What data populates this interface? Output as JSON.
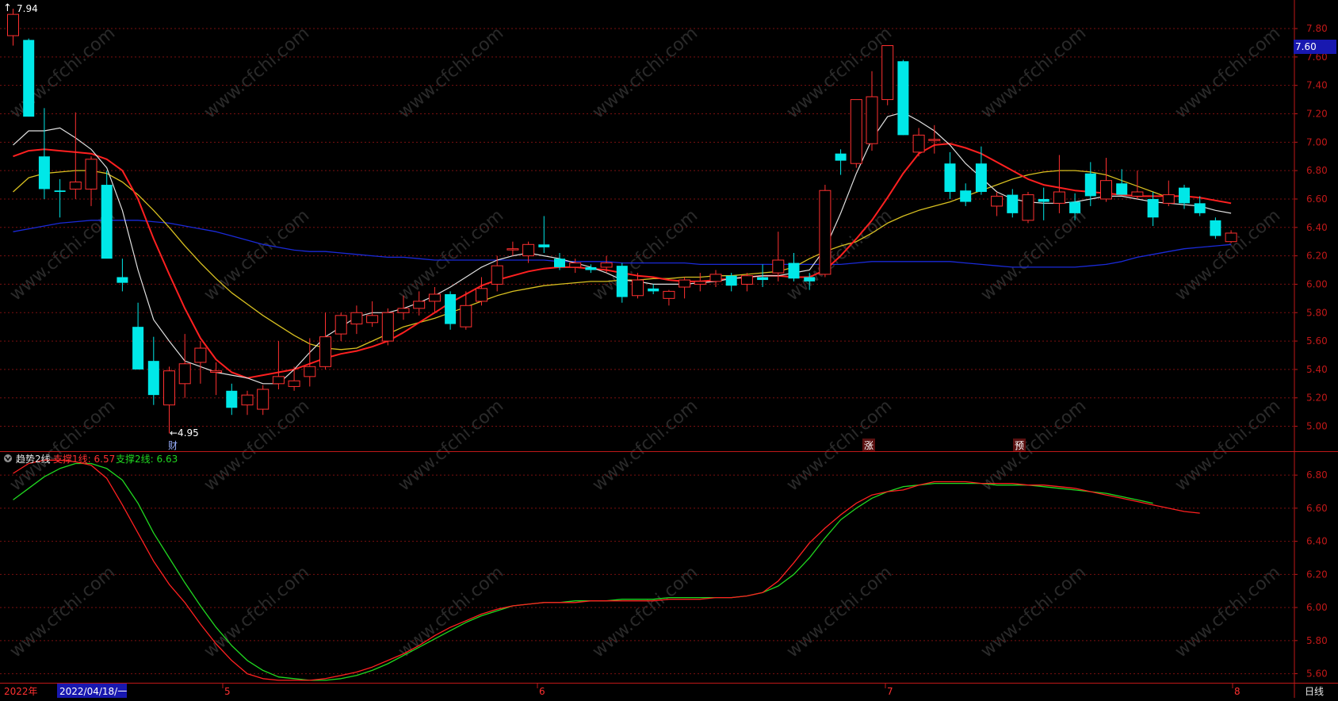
{
  "colors": {
    "background": "#000000",
    "grid": "#7a1010",
    "frame": "#c01818",
    "axis_text": "#c8c8c8",
    "candle_up": "#ff3030",
    "candle_down": "#00e8e8",
    "ma_white": "#e0e0e0",
    "ma_red": "#ff2020",
    "ma_yellow": "#d8c020",
    "ma_blue": "#1a2ad8",
    "support1": "#ff2020",
    "support2": "#20d820",
    "watermark": "#2a2a2a"
  },
  "watermark_text": "www.cfchi.com",
  "price_panel": {
    "y_ticks": [
      "7.80",
      "7.60",
      "7.40",
      "7.20",
      "7.00",
      "6.80",
      "6.60",
      "6.40",
      "6.20",
      "6.00",
      "5.80",
      "5.60",
      "5.40",
      "5.20",
      "5.00"
    ],
    "current_price_label": "7.60",
    "high_marker": "7.94",
    "low_marker": "←4.95",
    "event_markers": [
      "财",
      "涨",
      "预"
    ]
  },
  "indicator_panel": {
    "name": "趋势2线",
    "line1_label": "支撑1线: 6.57",
    "line2_label": "支撑2线: 6.63",
    "y_ticks": [
      "6.80",
      "6.60",
      "6.40",
      "6.20",
      "6.00",
      "5.80",
      "5.60"
    ]
  },
  "bottom_axis": {
    "year_label": "2022年",
    "selected_date": "2022/04/18/一",
    "months": [
      "5",
      "6",
      "7",
      "8"
    ],
    "period_label": "日线"
  },
  "chart_data": {
    "type": "candlestick",
    "price_range": [
      4.83,
      7.99
    ],
    "indicator_range": [
      5.55,
      6.93
    ],
    "candles": [
      {
        "o": 7.75,
        "h": 7.94,
        "l": 7.68,
        "c": 7.9
      },
      {
        "o": 7.72,
        "h": 7.73,
        "l": 7.18,
        "c": 7.18
      },
      {
        "o": 6.9,
        "h": 7.24,
        "l": 6.6,
        "c": 6.67
      },
      {
        "o": 6.66,
        "h": 6.74,
        "l": 6.47,
        "c": 6.65
      },
      {
        "o": 6.67,
        "h": 7.21,
        "l": 6.6,
        "c": 6.72
      },
      {
        "o": 6.67,
        "h": 6.9,
        "l": 6.55,
        "c": 6.88
      },
      {
        "o": 6.7,
        "h": 6.8,
        "l": 6.2,
        "c": 6.18
      },
      {
        "o": 6.05,
        "h": 6.18,
        "l": 5.95,
        "c": 6.01
      },
      {
        "o": 5.7,
        "h": 5.87,
        "l": 5.4,
        "c": 5.4
      },
      {
        "o": 5.46,
        "h": 5.63,
        "l": 5.15,
        "c": 5.22
      },
      {
        "o": 5.15,
        "h": 5.42,
        "l": 4.95,
        "c": 5.39
      },
      {
        "o": 5.3,
        "h": 5.65,
        "l": 5.2,
        "c": 5.44
      },
      {
        "o": 5.45,
        "h": 5.6,
        "l": 5.3,
        "c": 5.55
      },
      {
        "o": 5.38,
        "h": 5.45,
        "l": 5.22,
        "c": 5.39
      },
      {
        "o": 5.25,
        "h": 5.3,
        "l": 5.08,
        "c": 5.13
      },
      {
        "o": 5.15,
        "h": 5.25,
        "l": 5.08,
        "c": 5.22
      },
      {
        "o": 5.12,
        "h": 5.29,
        "l": 5.08,
        "c": 5.26
      },
      {
        "o": 5.3,
        "h": 5.6,
        "l": 5.26,
        "c": 5.35
      },
      {
        "o": 5.28,
        "h": 5.42,
        "l": 5.25,
        "c": 5.32
      },
      {
        "o": 5.35,
        "h": 5.62,
        "l": 5.28,
        "c": 5.42
      },
      {
        "o": 5.42,
        "h": 5.8,
        "l": 5.4,
        "c": 5.63
      },
      {
        "o": 5.65,
        "h": 5.8,
        "l": 5.6,
        "c": 5.78
      },
      {
        "o": 5.72,
        "h": 5.85,
        "l": 5.65,
        "c": 5.8
      },
      {
        "o": 5.73,
        "h": 5.88,
        "l": 5.7,
        "c": 5.78
      },
      {
        "o": 5.6,
        "h": 5.83,
        "l": 5.57,
        "c": 5.8
      },
      {
        "o": 5.8,
        "h": 5.92,
        "l": 5.75,
        "c": 5.83
      },
      {
        "o": 5.83,
        "h": 5.95,
        "l": 5.78,
        "c": 5.88
      },
      {
        "o": 5.88,
        "h": 5.98,
        "l": 5.8,
        "c": 5.93
      },
      {
        "o": 5.93,
        "h": 5.95,
        "l": 5.68,
        "c": 5.72
      },
      {
        "o": 5.7,
        "h": 5.95,
        "l": 5.68,
        "c": 5.85
      },
      {
        "o": 5.88,
        "h": 6.05,
        "l": 5.85,
        "c": 5.97
      },
      {
        "o": 6.0,
        "h": 6.2,
        "l": 5.95,
        "c": 6.13
      },
      {
        "o": 6.25,
        "h": 6.3,
        "l": 6.2,
        "c": 6.25
      },
      {
        "o": 6.2,
        "h": 6.3,
        "l": 6.15,
        "c": 6.28
      },
      {
        "o": 6.28,
        "h": 6.48,
        "l": 6.22,
        "c": 6.26
      },
      {
        "o": 6.18,
        "h": 6.22,
        "l": 6.1,
        "c": 6.12
      },
      {
        "o": 6.12,
        "h": 6.18,
        "l": 6.08,
        "c": 6.15
      },
      {
        "o": 6.12,
        "h": 6.14,
        "l": 6.08,
        "c": 6.1
      },
      {
        "o": 6.12,
        "h": 6.2,
        "l": 6.08,
        "c": 6.15
      },
      {
        "o": 6.13,
        "h": 6.15,
        "l": 5.87,
        "c": 5.91
      },
      {
        "o": 5.92,
        "h": 6.08,
        "l": 5.9,
        "c": 6.03
      },
      {
        "o": 5.97,
        "h": 6.0,
        "l": 5.93,
        "c": 5.95
      },
      {
        "o": 5.9,
        "h": 5.96,
        "l": 5.85,
        "c": 5.95
      },
      {
        "o": 5.98,
        "h": 6.05,
        "l": 5.9,
        "c": 6.03
      },
      {
        "o": 6.0,
        "h": 6.08,
        "l": 5.95,
        "c": 6.02
      },
      {
        "o": 6.02,
        "h": 6.1,
        "l": 5.98,
        "c": 6.07
      },
      {
        "o": 6.06,
        "h": 6.08,
        "l": 5.95,
        "c": 5.99
      },
      {
        "o": 6.0,
        "h": 6.08,
        "l": 5.95,
        "c": 6.06
      },
      {
        "o": 6.05,
        "h": 6.14,
        "l": 5.98,
        "c": 6.03
      },
      {
        "o": 6.08,
        "h": 6.37,
        "l": 6.02,
        "c": 6.17
      },
      {
        "o": 6.15,
        "h": 6.22,
        "l": 6.02,
        "c": 6.04
      },
      {
        "o": 6.05,
        "h": 6.08,
        "l": 5.96,
        "c": 6.02
      },
      {
        "o": 6.07,
        "h": 6.7,
        "l": 6.05,
        "c": 6.66
      },
      {
        "o": 6.92,
        "h": 6.95,
        "l": 6.77,
        "c": 6.87
      },
      {
        "o": 6.85,
        "h": 7.25,
        "l": 6.82,
        "c": 7.3
      },
      {
        "o": 6.99,
        "h": 7.5,
        "l": 6.94,
        "c": 7.32
      },
      {
        "o": 7.3,
        "h": 7.68,
        "l": 7.26,
        "c": 7.68
      },
      {
        "o": 7.57,
        "h": 7.58,
        "l": 7.05,
        "c": 7.05
      },
      {
        "o": 6.93,
        "h": 7.1,
        "l": 6.9,
        "c": 7.05
      },
      {
        "o": 7.02,
        "h": 7.12,
        "l": 6.92,
        "c": 7.02
      },
      {
        "o": 6.85,
        "h": 6.93,
        "l": 6.6,
        "c": 6.65
      },
      {
        "o": 6.66,
        "h": 6.71,
        "l": 6.55,
        "c": 6.58
      },
      {
        "o": 6.85,
        "h": 6.97,
        "l": 6.63,
        "c": 6.65
      },
      {
        "o": 6.55,
        "h": 6.65,
        "l": 6.48,
        "c": 6.62
      },
      {
        "o": 6.63,
        "h": 6.67,
        "l": 6.47,
        "c": 6.5
      },
      {
        "o": 6.45,
        "h": 6.65,
        "l": 6.43,
        "c": 6.63
      },
      {
        "o": 6.6,
        "h": 6.68,
        "l": 6.45,
        "c": 6.58
      },
      {
        "o": 6.57,
        "h": 6.91,
        "l": 6.5,
        "c": 6.65
      },
      {
        "o": 6.58,
        "h": 6.64,
        "l": 6.45,
        "c": 6.5
      },
      {
        "o": 6.78,
        "h": 6.86,
        "l": 6.55,
        "c": 6.62
      },
      {
        "o": 6.6,
        "h": 6.89,
        "l": 6.58,
        "c": 6.73
      },
      {
        "o": 6.71,
        "h": 6.81,
        "l": 6.63,
        "c": 6.63
      },
      {
        "o": 6.62,
        "h": 6.8,
        "l": 6.6,
        "c": 6.65
      },
      {
        "o": 6.6,
        "h": 6.65,
        "l": 6.41,
        "c": 6.47
      },
      {
        "o": 6.57,
        "h": 6.73,
        "l": 6.55,
        "c": 6.63
      },
      {
        "o": 6.68,
        "h": 6.7,
        "l": 6.53,
        "c": 6.57
      },
      {
        "o": 6.57,
        "h": 6.62,
        "l": 6.48,
        "c": 6.5
      },
      {
        "o": 6.45,
        "h": 6.47,
        "l": 6.32,
        "c": 6.34
      },
      {
        "o": 6.3,
        "h": 6.38,
        "l": 6.29,
        "c": 6.36
      }
    ],
    "ma_short": [
      6.98,
      7.08,
      7.08,
      7.1,
      7.03,
      6.95,
      6.82,
      6.52,
      6.1,
      5.75,
      5.6,
      5.46,
      5.42,
      5.38,
      5.36,
      5.34,
      5.3,
      5.3,
      5.4,
      5.52,
      5.63,
      5.7,
      5.77,
      5.8,
      5.8,
      5.83,
      5.87,
      5.92,
      5.98,
      6.05,
      6.12,
      6.17,
      6.2,
      6.22,
      6.2,
      6.18,
      6.15,
      6.12,
      6.08,
      6.03,
      6.02,
      6.0,
      6.0,
      6.0,
      6.01,
      6.02,
      6.04,
      6.05,
      6.06,
      6.06,
      6.08,
      6.1,
      6.25,
      6.5,
      6.78,
      7.02,
      7.18,
      7.21,
      7.15,
      7.08,
      6.98,
      6.85,
      6.75,
      6.65,
      6.6,
      6.58,
      6.57,
      6.57,
      6.58,
      6.6,
      6.62,
      6.62,
      6.6,
      6.58,
      6.57,
      6.56,
      6.55,
      6.52,
      6.5
    ],
    "ma_mid": [
      6.9,
      6.94,
      6.95,
      6.94,
      6.93,
      6.92,
      6.88,
      6.8,
      6.6,
      6.32,
      6.07,
      5.83,
      5.62,
      5.47,
      5.38,
      5.34,
      5.36,
      5.38,
      5.4,
      5.44,
      5.48,
      5.51,
      5.53,
      5.56,
      5.6,
      5.66,
      5.73,
      5.8,
      5.87,
      5.93,
      5.99,
      6.03,
      6.06,
      6.09,
      6.11,
      6.12,
      6.12,
      6.11,
      6.1,
      6.08,
      6.06,
      6.05,
      6.03,
      6.02,
      6.02,
      6.03,
      6.04,
      6.05,
      6.06,
      6.06,
      6.05,
      6.05,
      6.1,
      6.2,
      6.32,
      6.45,
      6.61,
      6.78,
      6.92,
      6.98,
      6.99,
      6.96,
      6.92,
      6.86,
      6.8,
      6.74,
      6.7,
      6.68,
      6.66,
      6.65,
      6.64,
      6.63,
      6.62,
      6.62,
      6.62,
      6.62,
      6.61,
      6.59,
      6.57
    ],
    "ma_yellow": [
      6.65,
      6.75,
      6.78,
      6.79,
      6.8,
      6.8,
      6.78,
      6.72,
      6.63,
      6.52,
      6.4,
      6.27,
      6.15,
      6.04,
      5.94,
      5.86,
      5.78,
      5.71,
      5.64,
      5.58,
      5.55,
      5.54,
      5.55,
      5.6,
      5.65,
      5.7,
      5.73,
      5.76,
      5.8,
      5.84,
      5.88,
      5.92,
      5.95,
      5.97,
      5.99,
      6.0,
      6.01,
      6.02,
      6.02,
      6.03,
      6.03,
      6.04,
      6.04,
      6.05,
      6.05,
      6.06,
      6.06,
      6.07,
      6.08,
      6.09,
      6.12,
      6.18,
      6.23,
      6.27,
      6.3,
      6.36,
      6.43,
      6.48,
      6.52,
      6.55,
      6.58,
      6.62,
      6.66,
      6.7,
      6.74,
      6.77,
      6.79,
      6.8,
      6.8,
      6.79,
      6.77,
      6.73,
      6.69,
      6.65,
      6.61
    ],
    "ma_blue": [
      6.37,
      6.39,
      6.41,
      6.43,
      6.44,
      6.45,
      6.45,
      6.45,
      6.45,
      6.44,
      6.43,
      6.41,
      6.39,
      6.37,
      6.34,
      6.31,
      6.28,
      6.26,
      6.24,
      6.23,
      6.23,
      6.22,
      6.21,
      6.2,
      6.19,
      6.19,
      6.18,
      6.17,
      6.17,
      6.17,
      6.17,
      6.17,
      6.17,
      6.17,
      6.17,
      6.16,
      6.16,
      6.16,
      6.16,
      6.15,
      6.15,
      6.15,
      6.15,
      6.15,
      6.14,
      6.14,
      6.14,
      6.14,
      6.14,
      6.14,
      6.14,
      6.14,
      6.14,
      6.14,
      6.15,
      6.16,
      6.16,
      6.16,
      6.16,
      6.16,
      6.16,
      6.15,
      6.14,
      6.13,
      6.12,
      6.12,
      6.12,
      6.12,
      6.12,
      6.13,
      6.14,
      6.16,
      6.19,
      6.21,
      6.23,
      6.25,
      6.26,
      6.27,
      6.28
    ],
    "support1": [
      6.81,
      6.87,
      6.89,
      6.89,
      6.88,
      6.86,
      6.78,
      6.62,
      6.45,
      6.28,
      6.14,
      6.03,
      5.9,
      5.78,
      5.68,
      5.6,
      5.57,
      5.56,
      5.56,
      5.56,
      5.57,
      5.59,
      5.61,
      5.64,
      5.68,
      5.72,
      5.77,
      5.83,
      5.88,
      5.92,
      5.96,
      5.99,
      6.01,
      6.02,
      6.03,
      6.03,
      6.03,
      6.04,
      6.04,
      6.04,
      6.04,
      6.04,
      6.05,
      6.05,
      6.05,
      6.06,
      6.06,
      6.07,
      6.09,
      6.16,
      6.27,
      6.39,
      6.48,
      6.56,
      6.63,
      6.68,
      6.7,
      6.71,
      6.74,
      6.76,
      6.76,
      6.76,
      6.75,
      6.75,
      6.75,
      6.74,
      6.74,
      6.73,
      6.72,
      6.7,
      6.68,
      6.66,
      6.64,
      6.62,
      6.6,
      6.58,
      6.57
    ],
    "support2": [
      6.65,
      6.72,
      6.79,
      6.84,
      6.87,
      6.87,
      6.84,
      6.77,
      6.63,
      6.45,
      6.3,
      6.15,
      6.01,
      5.88,
      5.77,
      5.68,
      5.62,
      5.58,
      5.57,
      5.56,
      5.56,
      5.57,
      5.59,
      5.62,
      5.66,
      5.71,
      5.76,
      5.81,
      5.86,
      5.91,
      5.95,
      5.98,
      6.01,
      6.02,
      6.03,
      6.03,
      6.04,
      6.04,
      6.04,
      6.05,
      6.05,
      6.05,
      6.06,
      6.06,
      6.06,
      6.06,
      6.06,
      6.07,
      6.09,
      6.13,
      6.2,
      6.3,
      6.42,
      6.53,
      6.6,
      6.66,
      6.7,
      6.73,
      6.74,
      6.75,
      6.75,
      6.75,
      6.75,
      6.74,
      6.74,
      6.74,
      6.73,
      6.72,
      6.71,
      6.7,
      6.69,
      6.67,
      6.65,
      6.63
    ]
  }
}
